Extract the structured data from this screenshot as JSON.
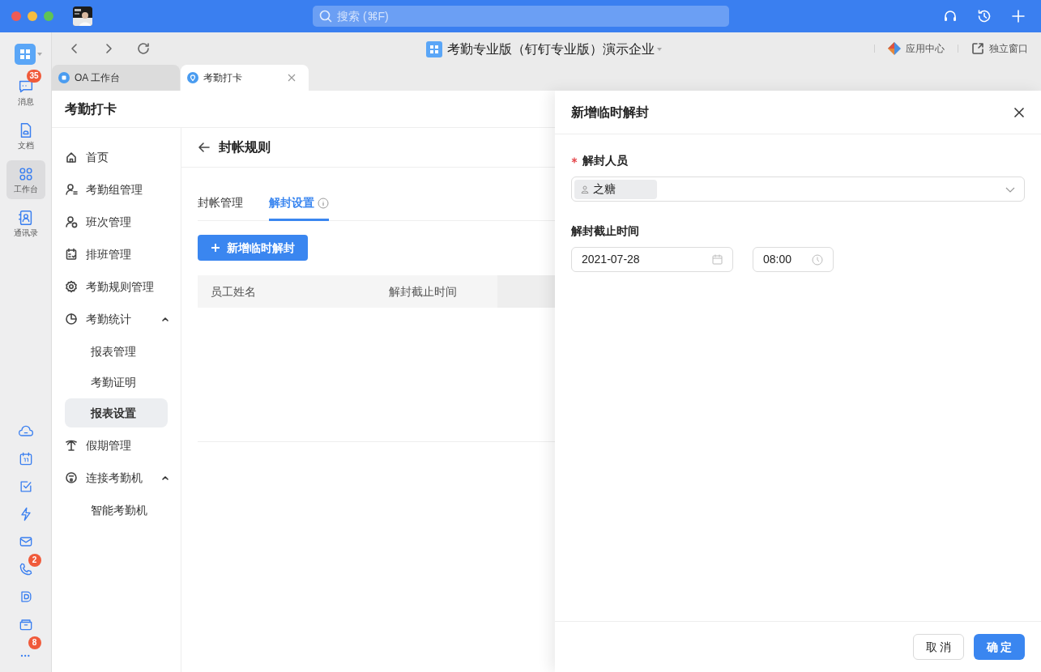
{
  "title_bar": {
    "search_placeholder": "搜索 (⌘F)"
  },
  "rail": {
    "items": [
      {
        "label": "消息",
        "badge": "35",
        "selected": false
      },
      {
        "label": "文档",
        "selected": false
      },
      {
        "label": "工作台",
        "selected": true
      },
      {
        "label": "通讯录",
        "selected": false
      }
    ],
    "phone_badge": "2",
    "more_badge": "8"
  },
  "toolbar": {
    "org_title": "考勤专业版（钉钉专业版）演示企业",
    "links": [
      "应用中心",
      "独立窗口"
    ]
  },
  "tabs": [
    {
      "label": "OA 工作台",
      "selected": false
    },
    {
      "label": "考勤打卡",
      "selected": true
    }
  ],
  "app": {
    "title": "考勤打卡",
    "nav": [
      {
        "label": "首页"
      },
      {
        "label": "考勤组管理"
      },
      {
        "label": "班次管理"
      },
      {
        "label": "排班管理"
      },
      {
        "label": "考勤规则管理"
      },
      {
        "label": "考勤统计",
        "expanded": true,
        "children": [
          {
            "label": "报表管理",
            "selected": false
          },
          {
            "label": "考勤证明",
            "selected": false
          },
          {
            "label": "报表设置",
            "selected": true
          }
        ]
      },
      {
        "label": "假期管理"
      },
      {
        "label": "连接考勤机",
        "expanded": true,
        "children": [
          {
            "label": "智能考勤机",
            "selected": false
          }
        ]
      }
    ]
  },
  "page": {
    "title": "封帐规则",
    "tabs": [
      {
        "label": "封帐管理",
        "selected": false,
        "info": false
      },
      {
        "label": "解封设置",
        "selected": true,
        "info": true
      }
    ],
    "add_button": "新增临时解封",
    "table": {
      "columns": [
        "员工姓名",
        "解封截止时间"
      ]
    }
  },
  "drawer": {
    "title": "新增临时解封",
    "fields": [
      {
        "kind": "people",
        "label": "解封人员",
        "required": true,
        "tags": [
          "之糖"
        ]
      },
      {
        "kind": "datetime",
        "label": "解封截止时间",
        "required": false,
        "date": "2021-07-28",
        "time": "08:00"
      }
    ],
    "buttons": [
      {
        "label": "取 消",
        "primary": false
      },
      {
        "label": "确 定",
        "primary": true
      }
    ]
  }
}
